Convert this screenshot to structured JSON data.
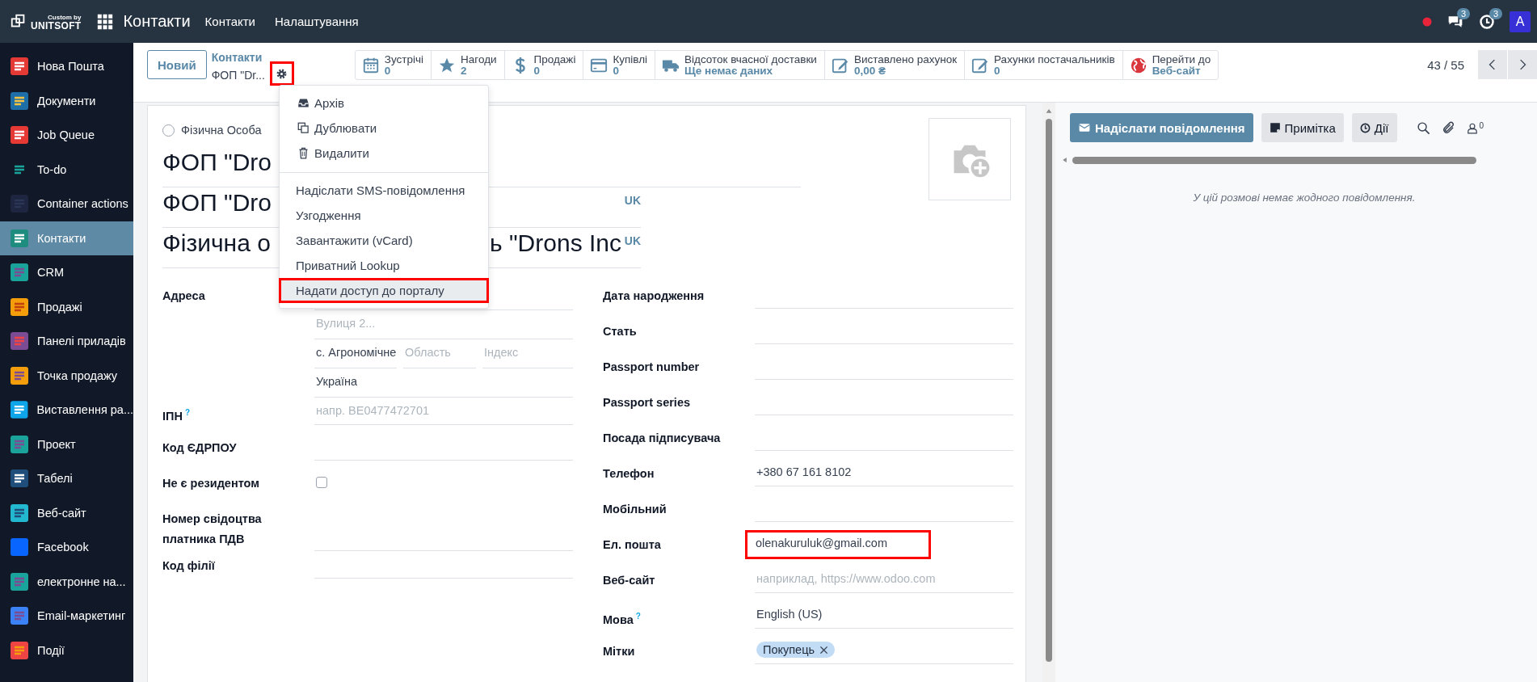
{
  "topbar": {
    "logo_top": "Custom by",
    "logo_bottom": "UNITSOFT",
    "app": "Контакти",
    "menus": [
      "Контакти",
      "Налаштування"
    ],
    "messages_badge": "3",
    "activities_badge": "3",
    "avatar": "A"
  },
  "sidebar": {
    "items": [
      {
        "label": "Нова Пошта",
        "selected": false
      },
      {
        "label": "Документи",
        "selected": false
      },
      {
        "label": "Job Queue",
        "selected": false
      },
      {
        "label": "To-do",
        "selected": false
      },
      {
        "label": "Container actions",
        "selected": false
      },
      {
        "label": "Контакти",
        "selected": true
      },
      {
        "label": "CRM",
        "selected": false
      },
      {
        "label": "Продажі",
        "selected": false
      },
      {
        "label": "Панелі приладів",
        "selected": false
      },
      {
        "label": "Точка продажу",
        "selected": false
      },
      {
        "label": "Виставлення ра...",
        "selected": false
      },
      {
        "label": "Проект",
        "selected": false
      },
      {
        "label": "Табелі",
        "selected": false
      },
      {
        "label": "Веб-сайт",
        "selected": false
      },
      {
        "label": "Facebook",
        "selected": false
      },
      {
        "label": "електронне на...",
        "selected": false
      },
      {
        "label": "Email-маркетинг",
        "selected": false
      },
      {
        "label": "Події",
        "selected": false
      }
    ]
  },
  "control_panel": {
    "new_button": "Новий",
    "breadcrumb": "Контакти",
    "record": "ФОП \"Dr...",
    "gear_highlighted": true,
    "smart_buttons": [
      {
        "kind": "calendar",
        "label": "Зустрічі",
        "value": "0"
      },
      {
        "kind": "star",
        "label": "Нагоди",
        "value": "2"
      },
      {
        "kind": "dollar",
        "label": "Продажі",
        "value": "0"
      },
      {
        "kind": "card",
        "label": "Купівлі",
        "value": "0"
      },
      {
        "kind": "truck",
        "label": "Відсоток вчасної доставки",
        "value": "Ще немає даних"
      },
      {
        "kind": "pencil",
        "label": "Виставлено рахунок",
        "value": "0,00 ₴"
      },
      {
        "kind": "pencil",
        "label": "Рахунки постачальників",
        "value": "0"
      },
      {
        "kind": "globe",
        "label": "Перейти до",
        "value": "Веб-сайт"
      }
    ],
    "pager": "43 / 55"
  },
  "actions_menu": {
    "sections": [
      {
        "items": [
          {
            "kind": "archive",
            "label": "Архів",
            "highlighted": false
          },
          {
            "kind": "copy",
            "label": "Дублювати",
            "highlighted": false
          },
          {
            "kind": "trash",
            "label": "Видалити",
            "highlighted": false
          }
        ]
      },
      {
        "items": [
          {
            "kind": "plain",
            "label": "Надіслати SMS-повідомлення",
            "highlighted": false
          },
          {
            "kind": "plain",
            "label": "Узгодження",
            "highlighted": false
          },
          {
            "kind": "plain",
            "label": "Завантажити (vCard)",
            "highlighted": false
          },
          {
            "kind": "plain",
            "label": "Приватний Lookup",
            "highlighted": false
          },
          {
            "kind": "plain",
            "label": "Надати доступ до порталу",
            "highlighted": true
          }
        ]
      }
    ]
  },
  "form": {
    "company_type": [
      {
        "label": "Фізична Особа",
        "selected": false
      }
    ],
    "name_lines": [
      {
        "text_start": "ФОП \"Dro"
      },
      {
        "text_start": "ФОП \"Dro",
        "lang": "UK"
      },
      {
        "text_start": "Фізична о",
        "text_end": "ь \"Drons Inc",
        "lang": "UK"
      }
    ],
    "left_fields": [
      {
        "kind": "address",
        "label": "Адреса",
        "street_placeholder": "Вулиця 2...",
        "city": "с. Агрономічне",
        "state_placeholder": "Область",
        "zip_placeholder": "Індекс",
        "country": "Україна"
      },
      {
        "kind": "text",
        "label": "ІПН",
        "help": "?",
        "placeholder": "напр. BE0477472701"
      },
      {
        "kind": "text",
        "label": "Код ЄДРПОУ"
      },
      {
        "kind": "checkbox",
        "label": "Не є резидентом",
        "checked": false
      },
      {
        "kind": "text",
        "label": "Номер свідоцтва платника ПДВ"
      },
      {
        "kind": "text",
        "label": "Код філії"
      }
    ],
    "right_fields": [
      {
        "kind": "text",
        "label": "Дата народження"
      },
      {
        "kind": "text",
        "label": "Стать"
      },
      {
        "kind": "text",
        "label": "Passport number"
      },
      {
        "kind": "text",
        "label": "Passport series"
      },
      {
        "kind": "text",
        "label": "Посада підписувача"
      },
      {
        "kind": "text",
        "label": "Телефон",
        "value": "+380 67 161 8102"
      },
      {
        "kind": "text",
        "label": "Мобільний"
      },
      {
        "kind": "text",
        "label": "Ел. пошта",
        "value": "olenakuruluk@gmail.com",
        "highlighted": true
      },
      {
        "kind": "text",
        "label": "Веб-сайт",
        "placeholder": "наприклад, https://www.odoo.com"
      },
      {
        "kind": "text",
        "label": "Мова",
        "help": "?",
        "value": "English (US)"
      },
      {
        "kind": "tags",
        "label": "Мітки",
        "tags": [
          "Покупець"
        ]
      }
    ]
  },
  "chatter": {
    "send_button": "Надіслати повідомлення",
    "note_button": "Примітка",
    "activities_button": "Дії",
    "followers_count": "0",
    "empty_message": "У цій розмові немає жодного повідомлення."
  }
}
